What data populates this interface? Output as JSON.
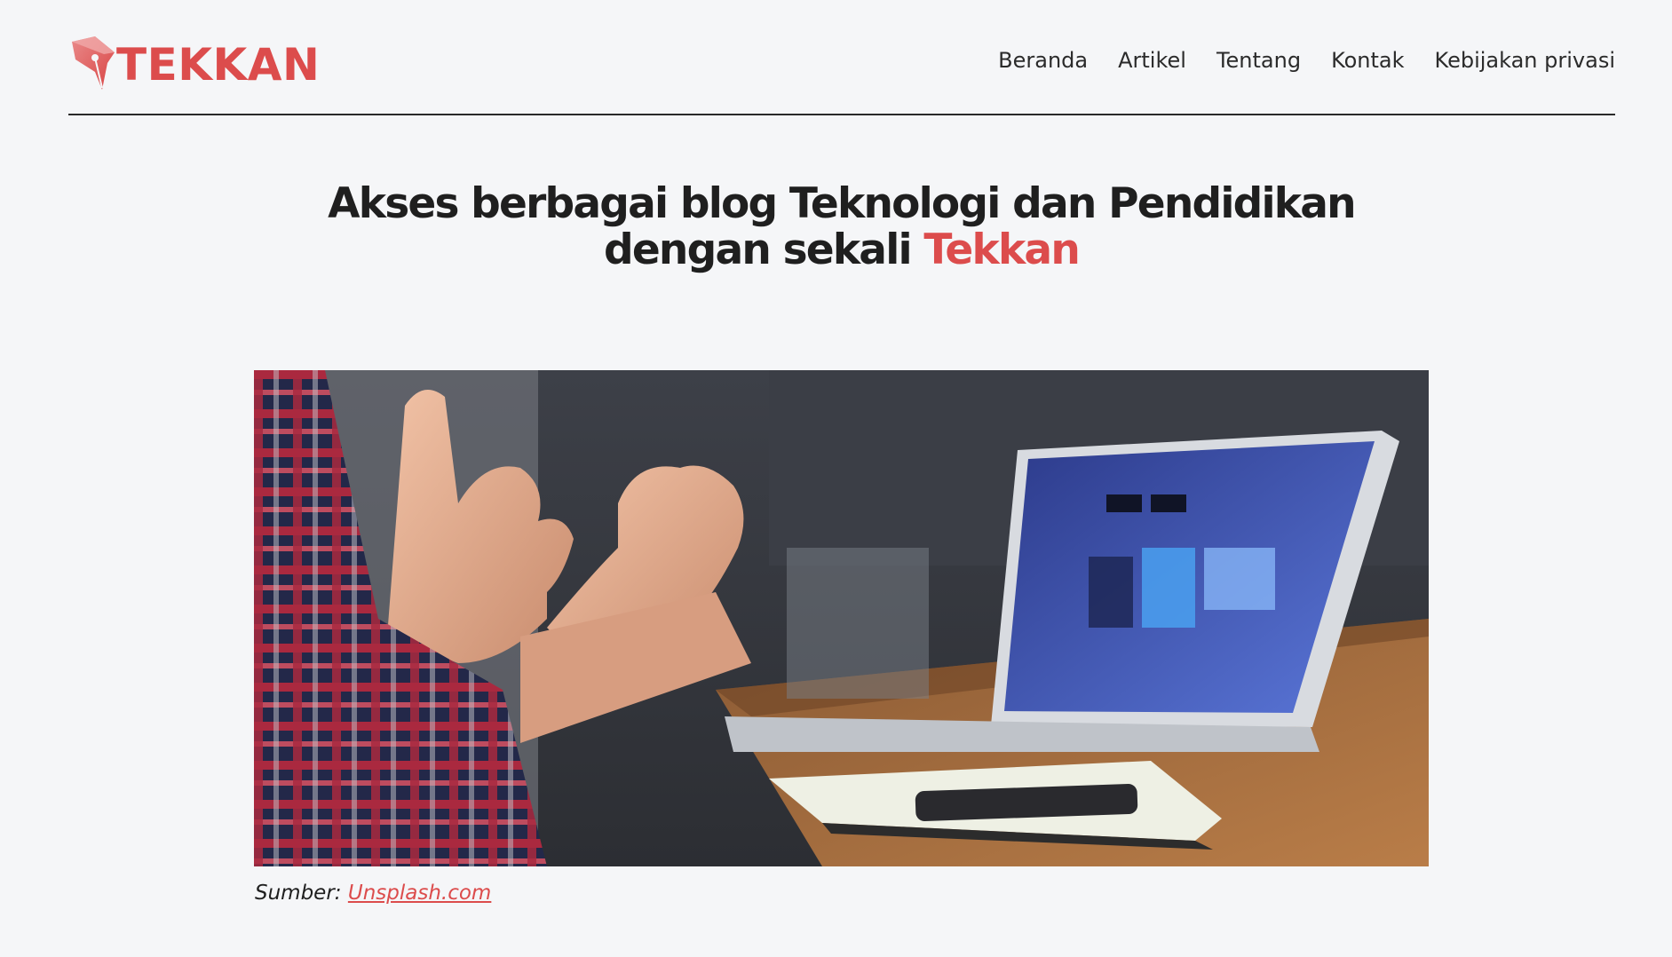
{
  "brand": {
    "name": "TEKKAN",
    "logo_icon": "pen-nib-icon",
    "accent_color": "#dc4c4c"
  },
  "nav": {
    "items": [
      {
        "label": "Beranda"
      },
      {
        "label": "Artikel"
      },
      {
        "label": "Tentang"
      },
      {
        "label": "Kontak"
      },
      {
        "label": "Kebijakan privasi"
      }
    ]
  },
  "hero": {
    "title_line1": "Akses berbagai blog Teknologi dan Pendidikan",
    "title_line2_prefix": "dengan sekali ",
    "title_highlight": "Tekkan"
  },
  "image": {
    "alt": "Orang berdiskusi di depan laptop"
  },
  "caption": {
    "prefix": "Sumber: ",
    "link_text": "Unsplash.com"
  }
}
